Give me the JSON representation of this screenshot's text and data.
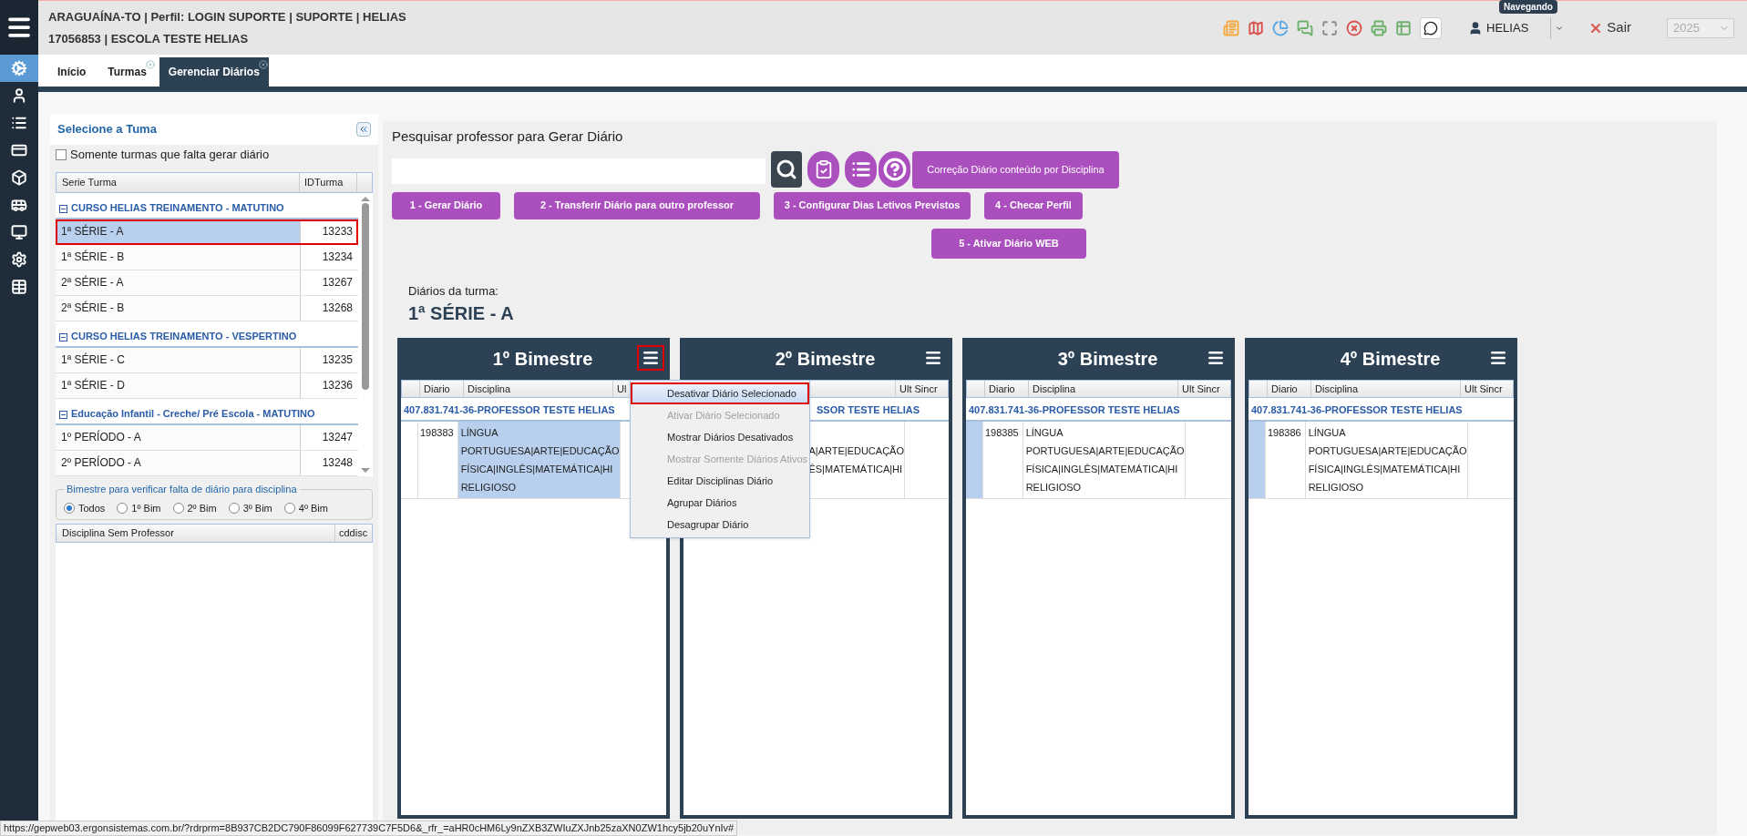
{
  "header": {
    "location_line": "ARAGUAÍNA-TO | Perfil: LOGIN SUPORTE | SUPORTE | HELIAS",
    "school_line": "17056853 | ESCOLA TESTE HELIAS",
    "user": "HELIAS",
    "user_tooltip": "Navegando",
    "logout": "Sair",
    "year": {
      "value": "2025",
      "disabled": true
    }
  },
  "sidebar": {
    "items": [
      {
        "selected": true
      },
      {
        "selected": false
      },
      {
        "selected": false
      },
      {
        "selected": false
      },
      {
        "selected": false
      },
      {
        "selected": false
      },
      {
        "selected": false
      },
      {
        "selected": false
      },
      {
        "selected": false
      }
    ]
  },
  "tabs": [
    {
      "label": "Início",
      "selected": false,
      "closable": false
    },
    {
      "label": "Turmas",
      "selected": false,
      "closable": true
    },
    {
      "label": "Gerenciar Diários",
      "selected": true,
      "closable": true
    }
  ],
  "left_panel": {
    "title": "Selecione a Tuma",
    "filter": {
      "label": "Somente turmas que falta gerar diário",
      "checked": false
    },
    "table": {
      "columns": [
        "Serie Turma",
        "IDTurma"
      ],
      "groups": [
        {
          "label": "CURSO HELIAS TREINAMENTO - MATUTINO",
          "expanded": true,
          "rows": [
            {
              "serie": "1ª SÉRIE - A",
              "id": "13233",
              "selected": true
            },
            {
              "serie": "1ª SÉRIE - B",
              "id": "13234",
              "selected": false
            },
            {
              "serie": "2ª SÉRIE - A",
              "id": "13267",
              "selected": false
            },
            {
              "serie": "2ª SÉRIE - B",
              "id": "13268",
              "selected": false
            }
          ]
        },
        {
          "label": "CURSO HELIAS TREINAMENTO - VESPERTINO",
          "expanded": true,
          "rows": [
            {
              "serie": "1ª SÉRIE - C",
              "id": "13235",
              "selected": false
            },
            {
              "serie": "1ª SÉRIE - D",
              "id": "13236",
              "selected": false
            }
          ]
        },
        {
          "label": "Educação Infantil - Creche/ Pré Escola - MATUTINO",
          "expanded": true,
          "rows": [
            {
              "serie": "1º PERÍODO - A",
              "id": "13247",
              "selected": false
            },
            {
              "serie": "2º PERÍODO - A",
              "id": "13248",
              "selected": false
            }
          ]
        }
      ]
    },
    "bimestre": {
      "legend": "Bimestre para verificar falta de diário para disciplina",
      "options": [
        {
          "label": "Todos",
          "selected": true
        },
        {
          "label": "1º Bim",
          "selected": false
        },
        {
          "label": "2º Bim",
          "selected": false
        },
        {
          "label": "3º Bim",
          "selected": false
        },
        {
          "label": "4º Bim",
          "selected": false
        }
      ]
    },
    "disciplinas_table": {
      "columns": [
        "Disciplina Sem Professor",
        "cddisc"
      ]
    }
  },
  "main": {
    "search_label": "Pesquisar professor para Gerar Diário",
    "correction_button": "Correção Diário conteúdo por Disciplina",
    "action_buttons": [
      "1 - Gerar Diário",
      "2 - Transferir Diário para outro professor",
      "3 - Configurar Dias Letivos Previstos",
      "4 - Checar Perfil"
    ],
    "second_row_buttons": [
      "5 - Ativar Diário WEB"
    ],
    "diarios_label": "Diários da turma:",
    "turma": "1ª SÉRIE - A",
    "cards": [
      {
        "title": "1º Bimestre",
        "kind": "full",
        "menu_open": true,
        "columns": [
          "Diario",
          "Disciplina",
          "Ul"
        ],
        "group": "407.831.741-36-PROFESSOR TESTE HELIAS",
        "rows": [
          {
            "diario": "198383",
            "disciplina": [
              "LÍNGUA",
              "PORTUGUESA|ARTE|EDUCAÇÃO",
              "FÍSICA|INGLÊS|MATEMÁTICA|HI",
              "RELIGIOSO"
            ],
            "marker_selected": false,
            "cell_selected": true
          }
        ]
      },
      {
        "title": "2º Bimestre",
        "kind": "covered",
        "menu_open": false,
        "columns": [
          "Ult Sincr"
        ],
        "group": "SSOR TESTE HELIAS",
        "rows": [
          {
            "disciplina": [
              "A|ARTE|EDUCAÇÃO",
              "ÊS|MATEMÁTICA|HI"
            ]
          }
        ]
      },
      {
        "title": "3º Bimestre",
        "kind": "full",
        "menu_open": false,
        "columns": [
          "Diario",
          "Disciplina",
          "Ult Sincr"
        ],
        "group": "407.831.741-36-PROFESSOR TESTE HELIAS",
        "rows": [
          {
            "diario": "198385",
            "disciplina": [
              "LÍNGUA",
              "PORTUGUESA|ARTE|EDUCAÇÃO",
              "FÍSICA|INGLÊS|MATEMÁTICA|HI",
              "RELIGIOSO"
            ],
            "marker_selected": true,
            "cell_selected": false
          }
        ]
      },
      {
        "title": "4º Bimestre",
        "kind": "full",
        "menu_open": false,
        "columns": [
          "Diario",
          "Disciplina",
          "Ult Sincr"
        ],
        "group": "407.831.741-36-PROFESSOR TESTE HELIAS",
        "rows": [
          {
            "diario": "198386",
            "disciplina": [
              "LÍNGUA",
              "PORTUGUESA|ARTE|EDUCAÇÃO",
              "FÍSICA|INGLÊS|MATEMÁTICA|HI",
              "RELIGIOSO"
            ],
            "marker_selected": true,
            "cell_selected": false
          }
        ]
      }
    ]
  },
  "menu": {
    "items": [
      {
        "label": "Desativar Diário Selecionado",
        "disabled": false,
        "selected": true
      },
      {
        "label": "Ativar Diário Selecionado",
        "disabled": true,
        "selected": false
      },
      {
        "label": "Mostrar Diários Desativados",
        "disabled": false,
        "selected": false
      },
      {
        "label": "Mostrar Somente Diários Ativos",
        "disabled": true,
        "selected": false
      },
      {
        "label": "Editar Disciplinas Diário",
        "disabled": false,
        "selected": false
      },
      {
        "label": "Agrupar Diários",
        "disabled": false,
        "selected": false
      },
      {
        "label": "Desagrupar Diário",
        "disabled": false,
        "selected": false
      }
    ]
  },
  "status_bar": {
    "url": "https://gepweb03.ergonsistemas.com.br/?rdrprm=8B937CB2DC790F86099F627739C7F5D6&_rfr_=aHR0cHM6Ly9nZXB3ZWIuZXJnb25zaXN0ZW1hcy5jb20uYnIv#"
  }
}
